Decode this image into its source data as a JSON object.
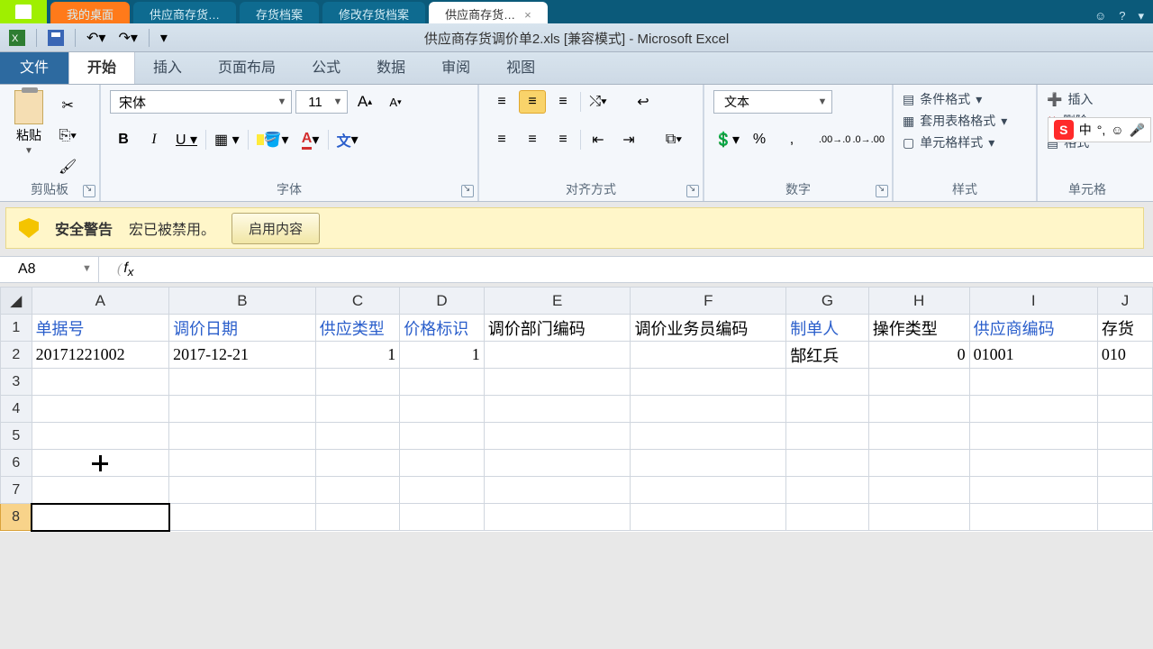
{
  "app_tabs": {
    "desktop": "我的桌面",
    "t1": "供应商存货…",
    "t2": "存货档案",
    "t3": "修改存货档案",
    "active": "供应商存货…"
  },
  "title": "供应商存货调价单2.xls  [兼容模式] - Microsoft Excel",
  "rtabs": {
    "file": "文件",
    "home": "开始",
    "insert": "插入",
    "layout": "页面布局",
    "formula": "公式",
    "data": "数据",
    "review": "审阅",
    "view": "视图"
  },
  "font": {
    "name": "宋体",
    "size": "11"
  },
  "number_format": "文本",
  "groups": {
    "clipboard": "剪贴板",
    "font": "字体",
    "align": "对齐方式",
    "number": "数字",
    "styles": "样式",
    "cells": "单元格"
  },
  "clipboard": {
    "paste": "粘贴"
  },
  "styles": {
    "cond": "条件格式",
    "tablefmt": "套用表格格式",
    "cellstyle": "单元格样式"
  },
  "cells": {
    "insert": "插入",
    "delete": "删除",
    "format": "格式"
  },
  "ime": {
    "lang": "中",
    "punct": "°,",
    "emoji": "☺"
  },
  "warning": {
    "title": "安全警告",
    "msg": "宏已被禁用。",
    "enable": "启用内容"
  },
  "namebox": "A8",
  "chart_data": {
    "type": "table",
    "headers": [
      "单据号",
      "调价日期",
      "供应类型",
      "价格标识",
      "调价部门编码",
      "调价业务员编码",
      "制单人",
      "操作类型",
      "供应商编码",
      "存货"
    ],
    "header_styles": [
      "blue",
      "blue",
      "blue",
      "blue",
      "black",
      "black",
      "blue",
      "black",
      "blue",
      "black"
    ],
    "rows": [
      [
        "20171221002",
        "2017-12-21",
        "1",
        "1",
        "",
        "",
        "郜红兵",
        "0",
        "01001",
        "010"
      ]
    ]
  },
  "cols": [
    "A",
    "B",
    "C",
    "D",
    "E",
    "F",
    "G",
    "H",
    "I",
    "J"
  ]
}
